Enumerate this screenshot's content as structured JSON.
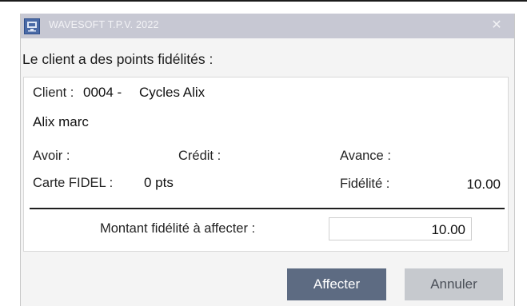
{
  "window": {
    "title": "WAVESOFT T.P.V. 2022",
    "close_glyph": "✕",
    "icon": "app-icon"
  },
  "prompt": "Le client a des points fidélités :",
  "client": {
    "label": "Client :",
    "code": "0004 -",
    "name": "Cycles Alix",
    "contact": "Alix marc"
  },
  "balances": {
    "avoir_label": "Avoir :",
    "avoir_value": "",
    "credit_label": "Crédit :",
    "credit_value": "",
    "avance_label": "Avance :",
    "avance_value": "",
    "carte_label": "Carte FIDEL :",
    "carte_value": "0 pts",
    "fidelite_label": "Fidélité :",
    "fidelite_value": "10.00"
  },
  "amount": {
    "label": "Montant fidélité à affecter :",
    "value": "10.00"
  },
  "buttons": {
    "affect": "Affecter",
    "cancel": "Annuler"
  },
  "colors": {
    "titlebar": "#c7c8d3",
    "primary_button": "#5d6b82",
    "secondary_button": "#c6c9ce"
  }
}
